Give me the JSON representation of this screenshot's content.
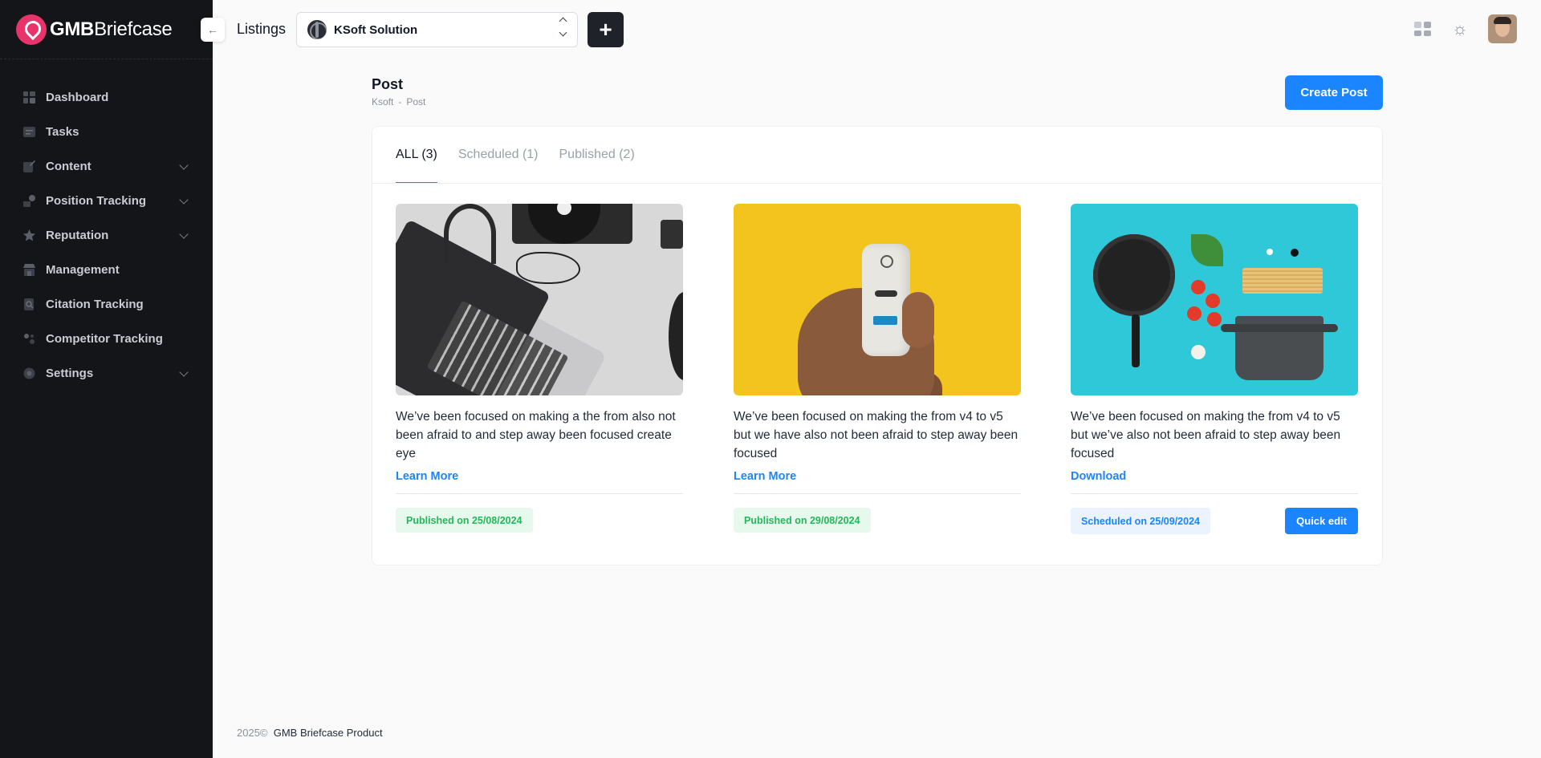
{
  "brand": {
    "bold": "GMB",
    "light": "Briefcase"
  },
  "sidebar": {
    "items": [
      {
        "label": "Dashboard",
        "icon": "dashboard-icon",
        "chevron": false
      },
      {
        "label": "Tasks",
        "icon": "tasks-icon",
        "chevron": false
      },
      {
        "label": "Content",
        "icon": "content-icon",
        "chevron": true
      },
      {
        "label": "Position Tracking",
        "icon": "position-tracking-icon",
        "chevron": true
      },
      {
        "label": "Reputation",
        "icon": "star-icon",
        "chevron": true
      },
      {
        "label": "Management",
        "icon": "store-icon",
        "chevron": false
      },
      {
        "label": "Citation Tracking",
        "icon": "citation-icon",
        "chevron": false
      },
      {
        "label": "Competitor Tracking",
        "icon": "competitor-icon",
        "chevron": false
      },
      {
        "label": "Settings",
        "icon": "settings-icon",
        "chevron": true
      }
    ]
  },
  "topbar": {
    "collapse_icon": "←",
    "listings_label": "Listings",
    "selected_listing": "KSoft Solution",
    "add_label": "+"
  },
  "page": {
    "title": "Post",
    "breadcrumb": [
      "Ksoft",
      "-",
      "Post"
    ],
    "create_button": "Create Post"
  },
  "tabs": [
    {
      "label": "ALL (3)",
      "active": true
    },
    {
      "label": "Scheduled (1)",
      "active": false
    },
    {
      "label": "Published (2)",
      "active": false
    }
  ],
  "posts": [
    {
      "text": "We’ve been focused on making a the from also not been afraid to and step away been focused create eye",
      "link": "Learn More",
      "status": "Published on 25/08/2024",
      "status_type": "published"
    },
    {
      "text": "We’ve been focused on making the from v4 to v5 but we have also not been afraid to step away been focused",
      "link": "Learn More",
      "status": "Published on 29/08/2024",
      "status_type": "published"
    },
    {
      "text": "We’ve been focused on making the from v4 to v5 but we’ve also not been afraid to step away been focused",
      "link": "Download",
      "status": "Scheduled on 25/09/2024",
      "status_type": "scheduled",
      "action": "Quick edit"
    }
  ],
  "footer": {
    "year": "2025©",
    "product": "GMB Briefcase Product"
  },
  "colors": {
    "primary": "#1b84ff",
    "sidebar": "#141519",
    "published": "#22b85a",
    "brand": "#e8336b"
  }
}
